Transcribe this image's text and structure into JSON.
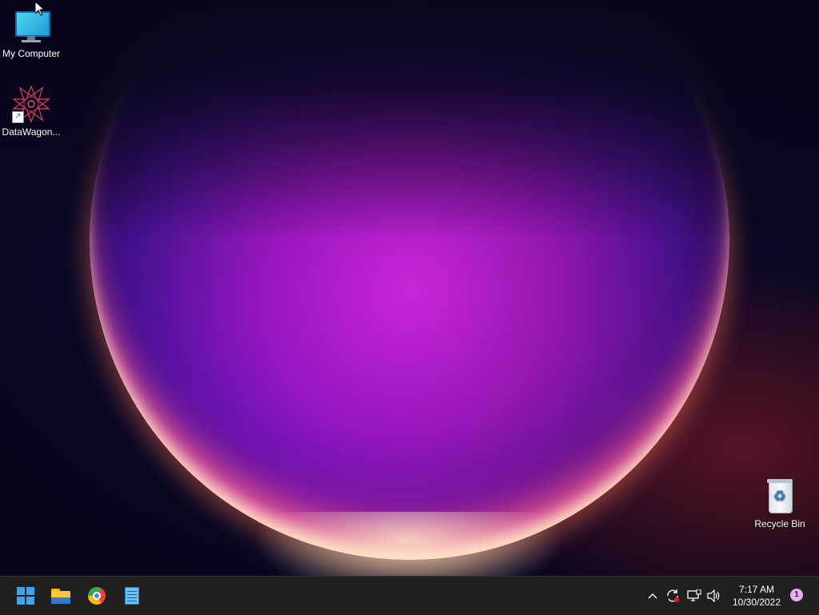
{
  "desktop": {
    "icons": [
      {
        "label": "My Computer",
        "icon": "monitor-icon"
      },
      {
        "label": "DataWagon...",
        "icon": "datawagon-icon"
      },
      {
        "label": "Recycle Bin",
        "icon": "recycle-bin-icon"
      }
    ]
  },
  "taskbar": {
    "pinned": [
      {
        "name": "Start",
        "icon": "windows-logo-icon"
      },
      {
        "name": "File Explorer",
        "icon": "folder-icon"
      },
      {
        "name": "Google Chrome",
        "icon": "chrome-icon"
      },
      {
        "name": "Notepad",
        "icon": "notepad-icon"
      }
    ],
    "tray": {
      "chevron": "^",
      "sync_icon": "sync-icon",
      "network_icon": "network-icon",
      "volume_icon": "volume-icon"
    },
    "clock": {
      "time": "7:17 AM",
      "date": "10/30/2022"
    },
    "notification_count": "1"
  },
  "colors": {
    "taskbar_bg": "#202020",
    "accent": "#3aa4f5"
  }
}
